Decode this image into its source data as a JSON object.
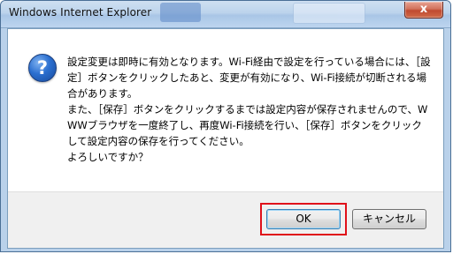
{
  "window": {
    "title": "Windows Internet Explorer",
    "close_label": "x"
  },
  "dialog": {
    "icon": "question-icon",
    "icon_glyph": "?",
    "message": "設定変更は即時に有効となります。Wi-Fi経由で設定を行っている場合には、［設定］ボタンをクリックしたあと、変更が有効になり、Wi-Fi接続が切断される場合があります。\nまた、［保存］ボタンをクリックするまでは設定内容が保存されませんので、WWWブラウザを一度終了し、再度Wi-Fi接続を行い、［保存］ボタンをクリックして設定内容の保存を行ってください。\nよろしいですか？"
  },
  "buttons": {
    "ok_label": "OK",
    "cancel_label": "キャンセル"
  },
  "colors": {
    "highlight": "#e0101a",
    "frame": "#b9d1ea"
  }
}
